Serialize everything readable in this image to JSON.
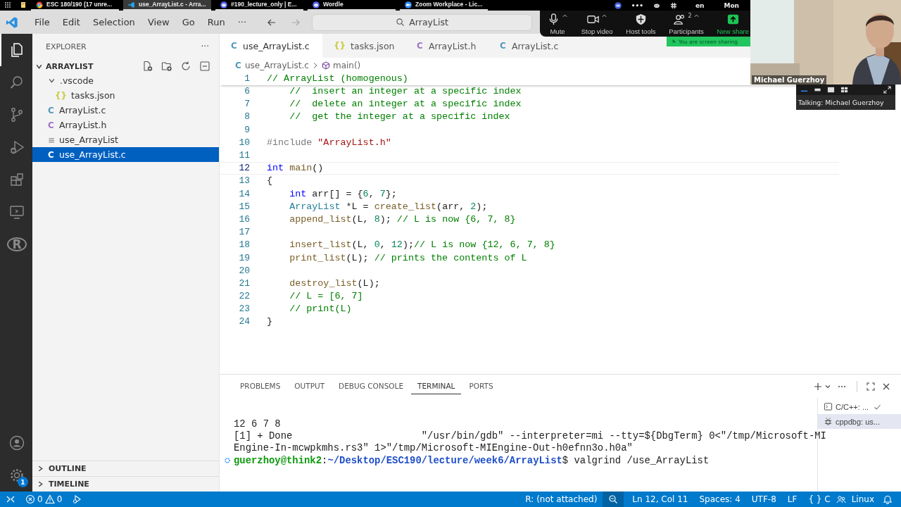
{
  "taskbar": {
    "items": [
      {
        "kind": "launcher",
        "selected": false
      },
      {
        "kind": "notes",
        "selected": false
      },
      {
        "kind": "chrome",
        "label": "ESC 180/190 (17 unre...",
        "selected": false
      },
      {
        "kind": "vscode",
        "label": "use_ArrayList.c - Arra...",
        "selected": true
      },
      {
        "kind": "discord",
        "label": "#190_lecture_only | E...",
        "selected": false
      },
      {
        "kind": "discord",
        "label": "Wordle",
        "selected": false
      },
      {
        "kind": "zoom",
        "label": "Zoom Workplace - Lic...",
        "selected": false
      }
    ],
    "tray": {
      "more": "•••",
      "language": "en",
      "clock": "Mon"
    }
  },
  "menu": [
    "File",
    "Edit",
    "Selection",
    "View",
    "Go",
    "Run",
    "···"
  ],
  "search": {
    "value": "ArrayList"
  },
  "zoom_toolbar": {
    "buttons": [
      {
        "kind": "mic",
        "label": "Mute"
      },
      {
        "kind": "camera",
        "label": "Stop video"
      },
      {
        "kind": "shield",
        "label": "Host tools"
      },
      {
        "kind": "people",
        "label": "Participants",
        "count": "2"
      },
      {
        "kind": "share",
        "label": "New share"
      }
    ],
    "banner": "You are screen sharing"
  },
  "video": {
    "name": "Michael Guerzhoy",
    "talking": "Talking: Michael Guerzhoy"
  },
  "activity_bar": {
    "items": [
      {
        "kind": "files",
        "selected": true
      },
      {
        "kind": "search",
        "selected": false
      },
      {
        "kind": "source_control",
        "selected": false
      },
      {
        "kind": "run_debug",
        "selected": false
      },
      {
        "kind": "extensions",
        "selected": false
      },
      {
        "kind": "remote",
        "selected": false
      },
      {
        "kind": "r",
        "glyph": "R",
        "selected": false
      }
    ],
    "settings_badge": "1"
  },
  "explorer": {
    "title": "EXPLORER",
    "more": "···",
    "folder": {
      "label": "ARRAYLIST",
      "expanded": true
    },
    "tree": [
      {
        "kind": "folder",
        "label": ".vscode",
        "expanded": true,
        "selected": false,
        "children": [
          {
            "kind": "json",
            "glyph": "{}",
            "label": "tasks.json",
            "selected": false
          }
        ]
      },
      {
        "kind": "c",
        "glyph": "C",
        "label": "ArrayList.c",
        "selected": false
      },
      {
        "kind": "h",
        "glyph": "C",
        "label": "ArrayList.h",
        "selected": false
      },
      {
        "kind": "binary",
        "glyph": "≡",
        "label": "use_ArrayList",
        "selected": false
      },
      {
        "kind": "c",
        "glyph": "C",
        "label": "use_ArrayList.c",
        "selected": true
      }
    ],
    "sections": [
      {
        "label": "OUTLINE",
        "expanded": false
      },
      {
        "label": "TIMELINE",
        "expanded": false
      }
    ]
  },
  "tabs": [
    {
      "kind": "c",
      "glyph": "C",
      "label": "use_ArrayList.c",
      "selected": true
    },
    {
      "kind": "json",
      "glyph": "{}",
      "label": "tasks.json",
      "selected": false
    },
    {
      "kind": "h",
      "glyph": "C",
      "label": "ArrayList.h",
      "selected": false
    },
    {
      "kind": "c",
      "glyph": "C",
      "label": "ArrayList.c",
      "selected": false
    }
  ],
  "breadcrumbs": [
    {
      "kind": "c",
      "glyph": "C",
      "label": "use_ArrayList.c"
    },
    {
      "kind": "function",
      "label": "main()"
    }
  ],
  "code": [
    {
      "number": "1",
      "sticky": true,
      "current": false,
      "tokens": [
        {
          "kind": "comment",
          "text": "// ArrayList (homogenous)"
        }
      ]
    },
    {
      "number": "6",
      "sticky": false,
      "current": false,
      "tokens": [
        {
          "kind": "comment",
          "text": "    //  insert an integer at a specific index"
        }
      ]
    },
    {
      "number": "7",
      "sticky": false,
      "current": false,
      "tokens": [
        {
          "kind": "comment",
          "text": "    //  delete an integer at a specific index"
        }
      ]
    },
    {
      "number": "8",
      "sticky": false,
      "current": false,
      "tokens": [
        {
          "kind": "comment",
          "text": "    //  get the integer at a specific index"
        }
      ]
    },
    {
      "number": "9",
      "sticky": false,
      "current": false
    },
    {
      "number": "10",
      "sticky": false,
      "current": false,
      "tokens": [
        {
          "kind": "preproc",
          "text": "#include "
        },
        {
          "kind": "string",
          "text": "\"ArrayList.h\""
        }
      ]
    },
    {
      "number": "11",
      "sticky": false,
      "current": false
    },
    {
      "number": "12",
      "sticky": false,
      "current": true,
      "tokens": [
        {
          "kind": "keyword",
          "text": "int "
        },
        {
          "kind": "function",
          "text": "main"
        },
        {
          "kind": "plain",
          "text": "()"
        }
      ]
    },
    {
      "number": "13",
      "sticky": false,
      "current": false,
      "tokens": [
        {
          "kind": "plain",
          "text": "{"
        }
      ]
    },
    {
      "number": "14",
      "sticky": false,
      "current": false,
      "tokens": [
        {
          "kind": "keyword",
          "text": "    int"
        },
        {
          "kind": "plain",
          "text": " arr[] = {"
        },
        {
          "kind": "number",
          "text": "6"
        },
        {
          "kind": "plain",
          "text": ", "
        },
        {
          "kind": "number",
          "text": "7"
        },
        {
          "kind": "plain",
          "text": "};"
        }
      ]
    },
    {
      "number": "15",
      "sticky": false,
      "current": false,
      "tokens": [
        {
          "kind": "type",
          "text": "    ArrayList"
        },
        {
          "kind": "plain",
          "text": " *L = "
        },
        {
          "kind": "function",
          "text": "create_list"
        },
        {
          "kind": "plain",
          "text": "(arr, "
        },
        {
          "kind": "number",
          "text": "2"
        },
        {
          "kind": "plain",
          "text": ");"
        }
      ]
    },
    {
      "number": "16",
      "sticky": false,
      "current": false,
      "tokens": [
        {
          "kind": "function",
          "text": "    append_list"
        },
        {
          "kind": "plain",
          "text": "(L, "
        },
        {
          "kind": "number",
          "text": "8"
        },
        {
          "kind": "plain",
          "text": "); "
        },
        {
          "kind": "comment",
          "text": "// L is now {6, 7, 8}"
        }
      ]
    },
    {
      "number": "17",
      "sticky": false,
      "current": false
    },
    {
      "number": "18",
      "sticky": false,
      "current": false,
      "tokens": [
        {
          "kind": "function",
          "text": "    insert_list"
        },
        {
          "kind": "plain",
          "text": "(L, "
        },
        {
          "kind": "number",
          "text": "0"
        },
        {
          "kind": "plain",
          "text": ", "
        },
        {
          "kind": "number",
          "text": "12"
        },
        {
          "kind": "plain",
          "text": ");"
        },
        {
          "kind": "comment",
          "text": "// L is now {12, 6, 7, 8}"
        }
      ]
    },
    {
      "number": "19",
      "sticky": false,
      "current": false,
      "tokens": [
        {
          "kind": "function",
          "text": "    print_list"
        },
        {
          "kind": "plain",
          "text": "(L); "
        },
        {
          "kind": "comment",
          "text": "// prints the contents of L"
        }
      ]
    },
    {
      "number": "20",
      "sticky": false,
      "current": false
    },
    {
      "number": "21",
      "sticky": false,
      "current": false,
      "tokens": [
        {
          "kind": "function",
          "text": "    destroy_list"
        },
        {
          "kind": "plain",
          "text": "(L);"
        }
      ]
    },
    {
      "number": "22",
      "sticky": false,
      "current": false,
      "tokens": [
        {
          "kind": "comment",
          "text": "    // L = [6, 7]"
        }
      ]
    },
    {
      "number": "23",
      "sticky": false,
      "current": false,
      "tokens": [
        {
          "kind": "comment",
          "text": "    // print(L)"
        }
      ]
    },
    {
      "number": "24",
      "sticky": false,
      "current": false,
      "tokens": [
        {
          "kind": "plain",
          "text": "}"
        }
      ]
    }
  ],
  "panel": {
    "tabs": [
      {
        "label": "PROBLEMS",
        "selected": false
      },
      {
        "label": "OUTPUT",
        "selected": false
      },
      {
        "label": "DEBUG CONSOLE",
        "selected": false
      },
      {
        "label": "TERMINAL",
        "selected": true
      },
      {
        "label": "PORTS",
        "selected": false
      }
    ],
    "terminal": [
      {
        "prompt": false,
        "tokens": [
          {
            "kind": "plain",
            "text": "12 6 7 8"
          }
        ]
      },
      {
        "prompt": false,
        "tokens": [
          {
            "kind": "plain",
            "text": "[1] + Done                      \"/usr/bin/gdb\" --interpreter=mi --tty=${DbgTerm} 0<\"/tmp/Microsoft-MI"
          }
        ]
      },
      {
        "prompt": false,
        "tokens": [
          {
            "kind": "plain",
            "text": "Engine-In-mcwpkmhs.rs3\" 1>\"/tmp/Microsoft-MIEngine-Out-h0efnn3o.h0a\""
          }
        ]
      },
      {
        "prompt": true,
        "tokens": [
          {
            "kind": "user",
            "text": "guerzhoy@think2"
          },
          {
            "kind": "plain",
            "text": ":"
          },
          {
            "kind": "path",
            "text": "~/Desktop/ESC190/lecture/week6/ArrayList"
          },
          {
            "kind": "plain",
            "text": "$ valgrind /use_ArrayList"
          }
        ]
      }
    ],
    "sessions": [
      {
        "kind": "terminal",
        "label": "C/C++: ...",
        "done": true,
        "selected": false
      },
      {
        "kind": "debug",
        "label": "cppdbg: us...",
        "done": false,
        "selected": true
      }
    ]
  },
  "status_bar": {
    "errors": "0",
    "warnings": "0",
    "items": [
      "R: (not attached)",
      "Ln 12, Col 11",
      "Spaces: 4",
      "UTF-8",
      "LF",
      "{ } C",
      "Linux"
    ]
  }
}
